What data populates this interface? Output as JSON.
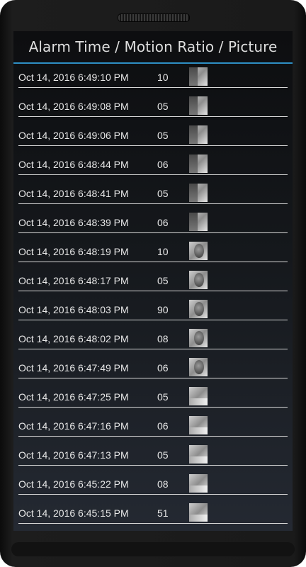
{
  "header": {
    "title": "Alarm Time / Motion Ratio / Picture"
  },
  "rows": [
    {
      "time": "Oct 14, 2016 6:49:10 PM",
      "ratio": "10",
      "picture": "motion-snapshot"
    },
    {
      "time": "Oct 14, 2016 6:49:08 PM",
      "ratio": "05",
      "picture": "motion-snapshot"
    },
    {
      "time": "Oct 14, 2016 6:49:06 PM",
      "ratio": "05",
      "picture": "motion-snapshot"
    },
    {
      "time": "Oct 14, 2016 6:48:44 PM",
      "ratio": "06",
      "picture": "motion-snapshot"
    },
    {
      "time": "Oct 14, 2016 6:48:41 PM",
      "ratio": "05",
      "picture": "motion-snapshot"
    },
    {
      "time": "Oct 14, 2016 6:48:39 PM",
      "ratio": "06",
      "picture": "motion-snapshot"
    },
    {
      "time": "Oct 14, 2016 6:48:19 PM",
      "ratio": "10",
      "picture": "motion-snapshot"
    },
    {
      "time": "Oct 14, 2016 6:48:17 PM",
      "ratio": "05",
      "picture": "motion-snapshot"
    },
    {
      "time": "Oct 14, 2016 6:48:03 PM",
      "ratio": "90",
      "picture": "motion-snapshot"
    },
    {
      "time": "Oct 14, 2016 6:48:02 PM",
      "ratio": "08",
      "picture": "motion-snapshot"
    },
    {
      "time": "Oct 14, 2016 6:47:49 PM",
      "ratio": "06",
      "picture": "motion-snapshot"
    },
    {
      "time": "Oct 14, 2016 6:47:25 PM",
      "ratio": "05",
      "picture": "motion-snapshot"
    },
    {
      "time": "Oct 14, 2016 6:47:16 PM",
      "ratio": "06",
      "picture": "motion-snapshot"
    },
    {
      "time": "Oct 14, 2016 6:47:13 PM",
      "ratio": "05",
      "picture": "motion-snapshot"
    },
    {
      "time": "Oct 14, 2016 6:45:22 PM",
      "ratio": "08",
      "picture": "motion-snapshot"
    },
    {
      "time": "Oct 14, 2016 6:45:15 PM",
      "ratio": "51",
      "picture": "motion-snapshot"
    }
  ],
  "colors": {
    "accent": "#2e8fc4",
    "text": "#e8e8e8",
    "divider": "#d8d8d8"
  }
}
